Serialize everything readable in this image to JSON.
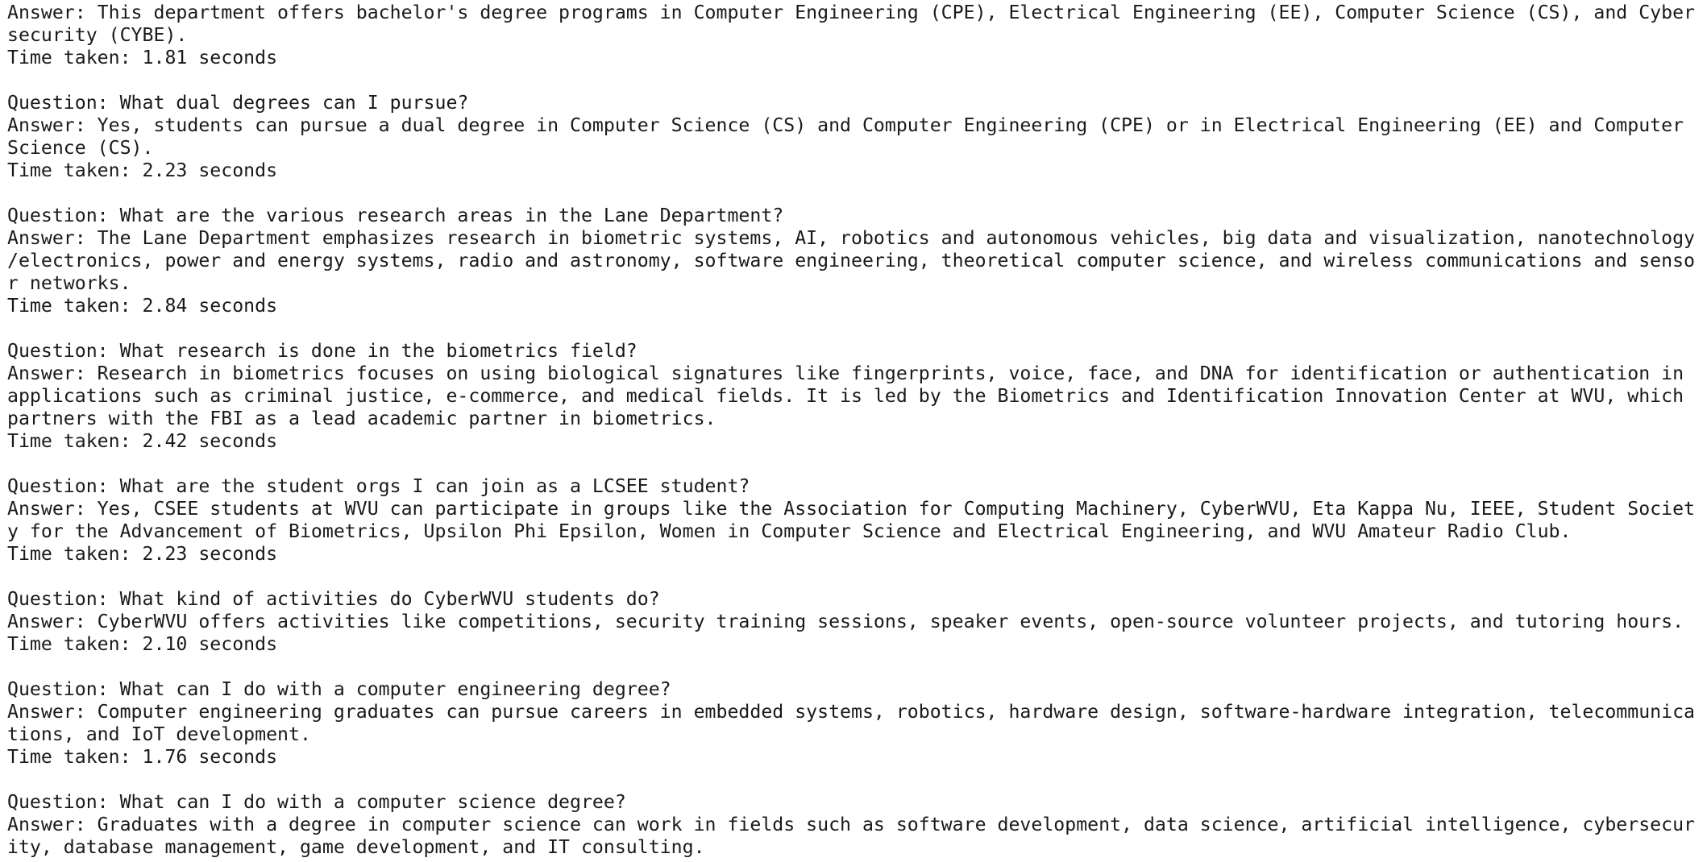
{
  "terminal": {
    "lines": [
      "Answer: This department offers bachelor's degree programs in Computer Engineering (CPE), Electrical Engineering (EE), Computer Science (CS), and Cyber",
      "security (CYBE).",
      "Time taken: 1.81 seconds",
      "",
      "Question: What dual degrees can I pursue?",
      "Answer: Yes, students can pursue a dual degree in Computer Science (CS) and Computer Engineering (CPE) or in Electrical Engineering (EE) and Computer",
      "Science (CS).",
      "Time taken: 2.23 seconds",
      "",
      "Question: What are the various research areas in the Lane Department?",
      "Answer: The Lane Department emphasizes research in biometric systems, AI, robotics and autonomous vehicles, big data and visualization, nanotechnology",
      "/electronics, power and energy systems, radio and astronomy, software engineering, theoretical computer science, and wireless communications and senso",
      "r networks.",
      "Time taken: 2.84 seconds",
      "",
      "Question: What research is done in the biometrics field?",
      "Answer: Research in biometrics focuses on using biological signatures like fingerprints, voice, face, and DNA for identification or authentication in",
      "applications such as criminal justice, e-commerce, and medical fields. It is led by the Biometrics and Identification Innovation Center at WVU, which",
      "partners with the FBI as a lead academic partner in biometrics.",
      "Time taken: 2.42 seconds",
      "",
      "Question: What are the student orgs I can join as a LCSEE student?",
      "Answer: Yes, CSEE students at WVU can participate in groups like the Association for Computing Machinery, CyberWVU, Eta Kappa Nu, IEEE, Student Societ",
      "y for the Advancement of Biometrics, Upsilon Phi Epsilon, Women in Computer Science and Electrical Engineering, and WVU Amateur Radio Club.",
      "Time taken: 2.23 seconds",
      "",
      "Question: What kind of activities do CyberWVU students do?",
      "Answer: CyberWVU offers activities like competitions, security training sessions, speaker events, open-source volunteer projects, and tutoring hours.",
      "Time taken: 2.10 seconds",
      "",
      "Question: What can I do with a computer engineering degree?",
      "Answer: Computer engineering graduates can pursue careers in embedded systems, robotics, hardware design, software-hardware integration, telecommunica",
      "tions, and IoT development.",
      "Time taken: 1.76 seconds",
      "",
      "Question: What can I do with a computer science degree?",
      "Answer: Graduates with a degree in computer science can work in fields such as software development, data science, artificial intelligence, cybersecur",
      "ity, database management, game development, and IT consulting."
    ]
  }
}
